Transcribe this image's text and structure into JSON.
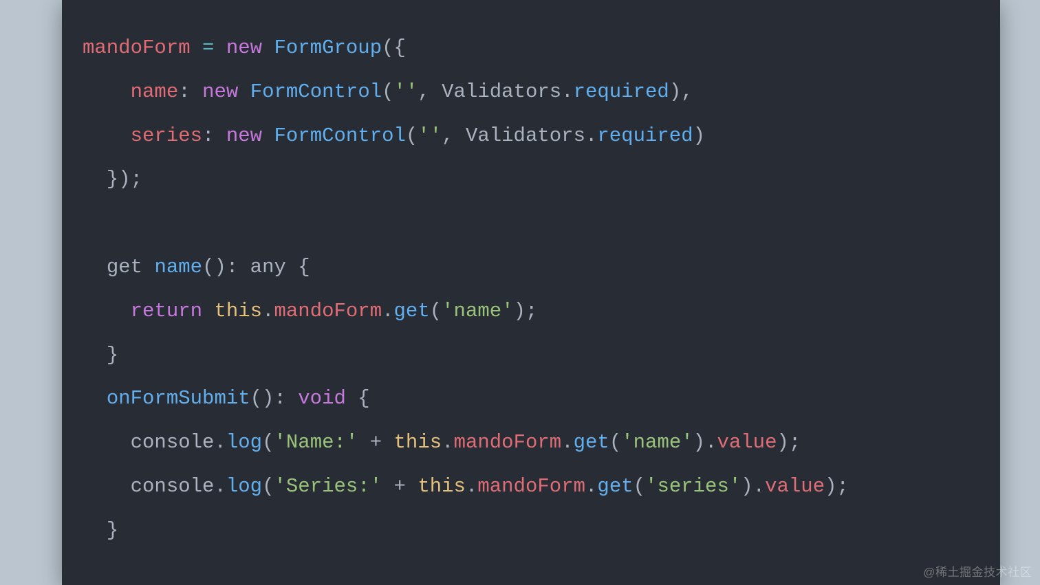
{
  "code": {
    "lines": [
      {
        "indent": "",
        "tokens": [
          {
            "t": "mandoForm ",
            "cls": "tok-field"
          },
          {
            "t": "= ",
            "cls": "tok-op"
          },
          {
            "t": "new ",
            "cls": "tok-kw"
          },
          {
            "t": "FormGroup",
            "cls": "tok-method"
          },
          {
            "t": "({",
            "cls": "tok-default"
          }
        ]
      },
      {
        "indent": "    ",
        "tokens": [
          {
            "t": "name",
            "cls": "tok-field"
          },
          {
            "t": ": ",
            "cls": "tok-default"
          },
          {
            "t": "new ",
            "cls": "tok-kw"
          },
          {
            "t": "FormControl",
            "cls": "tok-method"
          },
          {
            "t": "(",
            "cls": "tok-default"
          },
          {
            "t": "''",
            "cls": "tok-str"
          },
          {
            "t": ", Validators.",
            "cls": "tok-default"
          },
          {
            "t": "required",
            "cls": "tok-method"
          },
          {
            "t": "),",
            "cls": "tok-default"
          }
        ]
      },
      {
        "indent": "    ",
        "tokens": [
          {
            "t": "series",
            "cls": "tok-field"
          },
          {
            "t": ": ",
            "cls": "tok-default"
          },
          {
            "t": "new ",
            "cls": "tok-kw"
          },
          {
            "t": "FormControl",
            "cls": "tok-method"
          },
          {
            "t": "(",
            "cls": "tok-default"
          },
          {
            "t": "''",
            "cls": "tok-str"
          },
          {
            "t": ", Validators.",
            "cls": "tok-default"
          },
          {
            "t": "required",
            "cls": "tok-method"
          },
          {
            "t": ")",
            "cls": "tok-default"
          }
        ]
      },
      {
        "indent": "  ",
        "tokens": [
          {
            "t": "});",
            "cls": "tok-default"
          }
        ]
      },
      {
        "indent": "",
        "tokens": []
      },
      {
        "indent": "  ",
        "tokens": [
          {
            "t": "get ",
            "cls": "tok-default"
          },
          {
            "t": "name",
            "cls": "tok-method"
          },
          {
            "t": "(): any {",
            "cls": "tok-default"
          }
        ]
      },
      {
        "indent": "    ",
        "tokens": [
          {
            "t": "return ",
            "cls": "tok-kw"
          },
          {
            "t": "this",
            "cls": "tok-prop"
          },
          {
            "t": ".",
            "cls": "tok-default"
          },
          {
            "t": "mandoForm",
            "cls": "tok-field"
          },
          {
            "t": ".",
            "cls": "tok-default"
          },
          {
            "t": "get",
            "cls": "tok-method"
          },
          {
            "t": "(",
            "cls": "tok-default"
          },
          {
            "t": "'name'",
            "cls": "tok-str"
          },
          {
            "t": ");",
            "cls": "tok-default"
          }
        ]
      },
      {
        "indent": "  ",
        "tokens": [
          {
            "t": "}",
            "cls": "tok-default"
          }
        ]
      },
      {
        "indent": "  ",
        "tokens": [
          {
            "t": "onFormSubmit",
            "cls": "tok-method"
          },
          {
            "t": "(): ",
            "cls": "tok-default"
          },
          {
            "t": "void",
            "cls": "tok-type"
          },
          {
            "t": " {",
            "cls": "tok-default"
          }
        ]
      },
      {
        "indent": "    ",
        "tokens": [
          {
            "t": "console.",
            "cls": "tok-default"
          },
          {
            "t": "log",
            "cls": "tok-method"
          },
          {
            "t": "(",
            "cls": "tok-default"
          },
          {
            "t": "'Name:'",
            "cls": "tok-str"
          },
          {
            "t": " + ",
            "cls": "tok-default"
          },
          {
            "t": "this",
            "cls": "tok-prop"
          },
          {
            "t": ".",
            "cls": "tok-default"
          },
          {
            "t": "mandoForm",
            "cls": "tok-field"
          },
          {
            "t": ".",
            "cls": "tok-default"
          },
          {
            "t": "get",
            "cls": "tok-method"
          },
          {
            "t": "(",
            "cls": "tok-default"
          },
          {
            "t": "'name'",
            "cls": "tok-str"
          },
          {
            "t": ").",
            "cls": "tok-default"
          },
          {
            "t": "value",
            "cls": "tok-field"
          },
          {
            "t": ");",
            "cls": "tok-default"
          }
        ]
      },
      {
        "indent": "    ",
        "tokens": [
          {
            "t": "console.",
            "cls": "tok-default"
          },
          {
            "t": "log",
            "cls": "tok-method"
          },
          {
            "t": "(",
            "cls": "tok-default"
          },
          {
            "t": "'Series:'",
            "cls": "tok-str"
          },
          {
            "t": " + ",
            "cls": "tok-default"
          },
          {
            "t": "this",
            "cls": "tok-prop"
          },
          {
            "t": ".",
            "cls": "tok-default"
          },
          {
            "t": "mandoForm",
            "cls": "tok-field"
          },
          {
            "t": ".",
            "cls": "tok-default"
          },
          {
            "t": "get",
            "cls": "tok-method"
          },
          {
            "t": "(",
            "cls": "tok-default"
          },
          {
            "t": "'series'",
            "cls": "tok-str"
          },
          {
            "t": ").",
            "cls": "tok-default"
          },
          {
            "t": "value",
            "cls": "tok-field"
          },
          {
            "t": ");",
            "cls": "tok-default"
          }
        ]
      },
      {
        "indent": "  ",
        "tokens": [
          {
            "t": "}",
            "cls": "tok-default"
          }
        ]
      }
    ]
  },
  "watermark": "@稀土掘金技术社区"
}
